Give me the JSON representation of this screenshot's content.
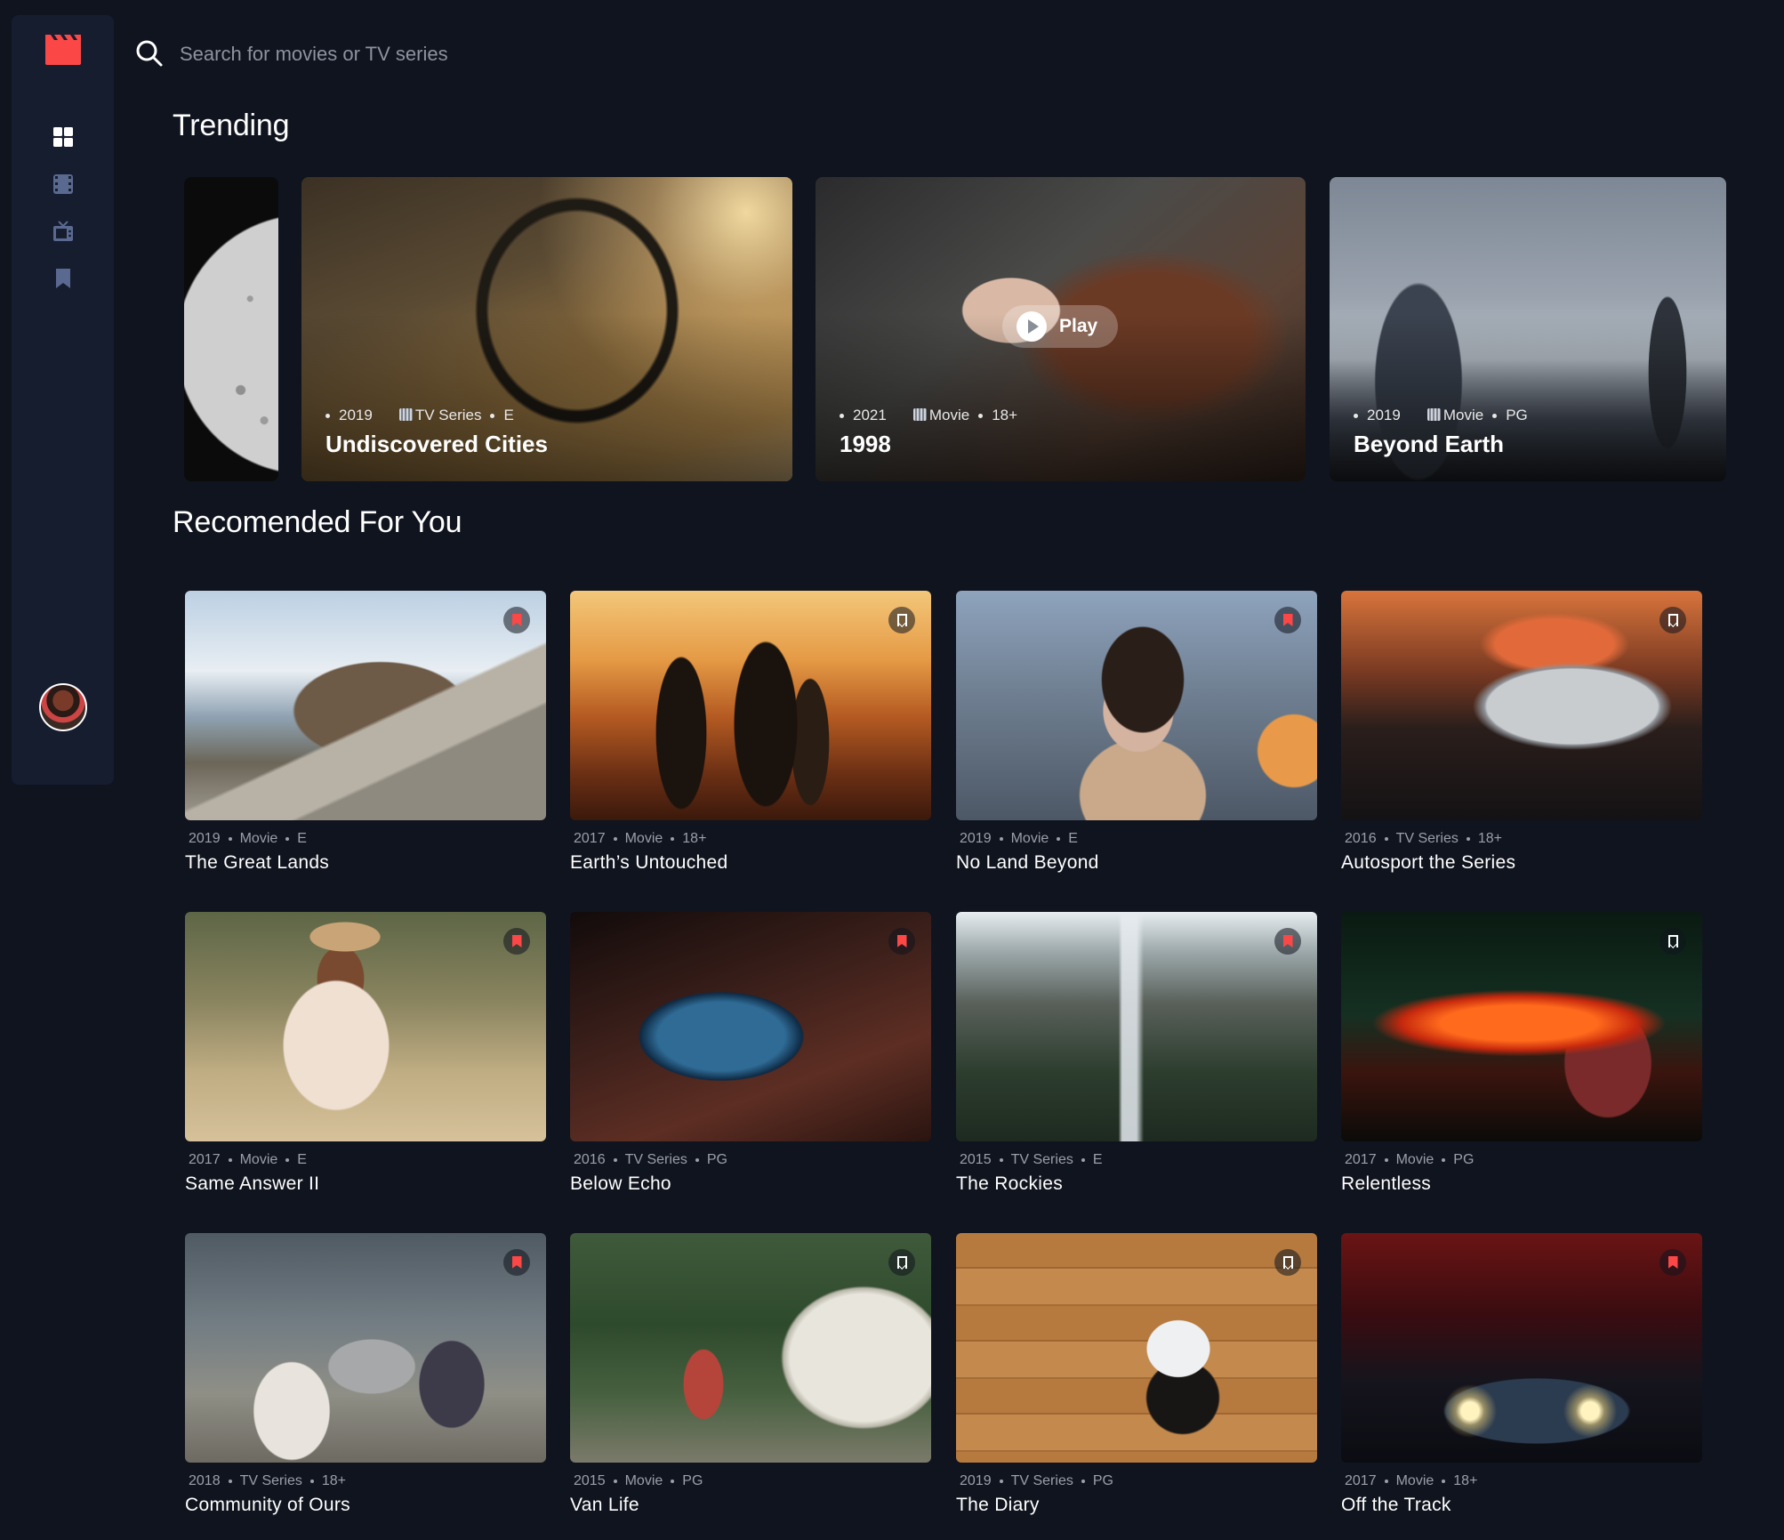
{
  "brand": {
    "accent": "#fc4747",
    "background": "#10141e",
    "sidebar": "#161d2f",
    "logo_icon": "clapperboard-icon"
  },
  "nav": [
    {
      "name": "home",
      "icon": "grid-icon",
      "active": true
    },
    {
      "name": "movies",
      "icon": "film-icon",
      "active": false
    },
    {
      "name": "tv-series",
      "icon": "tv-icon",
      "active": false
    },
    {
      "name": "bookmarks",
      "icon": "bookmark-icon",
      "active": false
    }
  ],
  "search": {
    "placeholder": "Search for movies or TV series",
    "value": ""
  },
  "trending": {
    "title": "Trending",
    "play_label": "Play",
    "items": [
      {
        "year": "2019",
        "category": "TV Series",
        "rating": "E",
        "title": "Undiscovered Cities"
      },
      {
        "year": "2021",
        "category": "Movie",
        "rating": "18+",
        "title": "1998"
      },
      {
        "year": "2019",
        "category": "Movie",
        "rating": "PG",
        "title": "Beyond Earth"
      }
    ]
  },
  "recommended": {
    "title": "Recomended For You",
    "items": [
      {
        "year": "2019",
        "category": "Movie",
        "rating": "E",
        "title": "The Great Lands",
        "bookmarked": true
      },
      {
        "year": "2017",
        "category": "Movie",
        "rating": "18+",
        "title": "Earth’s Untouched",
        "bookmarked": false
      },
      {
        "year": "2019",
        "category": "Movie",
        "rating": "E",
        "title": "No Land Beyond",
        "bookmarked": true
      },
      {
        "year": "2016",
        "category": "TV Series",
        "rating": "18+",
        "title": "Autosport the Series",
        "bookmarked": false
      },
      {
        "year": "2017",
        "category": "Movie",
        "rating": "E",
        "title": "Same Answer II",
        "bookmarked": true
      },
      {
        "year": "2016",
        "category": "TV Series",
        "rating": "PG",
        "title": "Below Echo",
        "bookmarked": true
      },
      {
        "year": "2015",
        "category": "TV Series",
        "rating": "E",
        "title": "The Rockies",
        "bookmarked": true
      },
      {
        "year": "2017",
        "category": "Movie",
        "rating": "PG",
        "title": "Relentless",
        "bookmarked": false
      },
      {
        "year": "2018",
        "category": "TV Series",
        "rating": "18+",
        "title": "Community of Ours",
        "bookmarked": true
      },
      {
        "year": "2015",
        "category": "Movie",
        "rating": "PG",
        "title": "Van Life",
        "bookmarked": false
      },
      {
        "year": "2019",
        "category": "TV Series",
        "rating": "PG",
        "title": "The Diary",
        "bookmarked": false
      },
      {
        "year": "2017",
        "category": "Movie",
        "rating": "18+",
        "title": "Off the Track",
        "bookmarked": true
      }
    ]
  }
}
